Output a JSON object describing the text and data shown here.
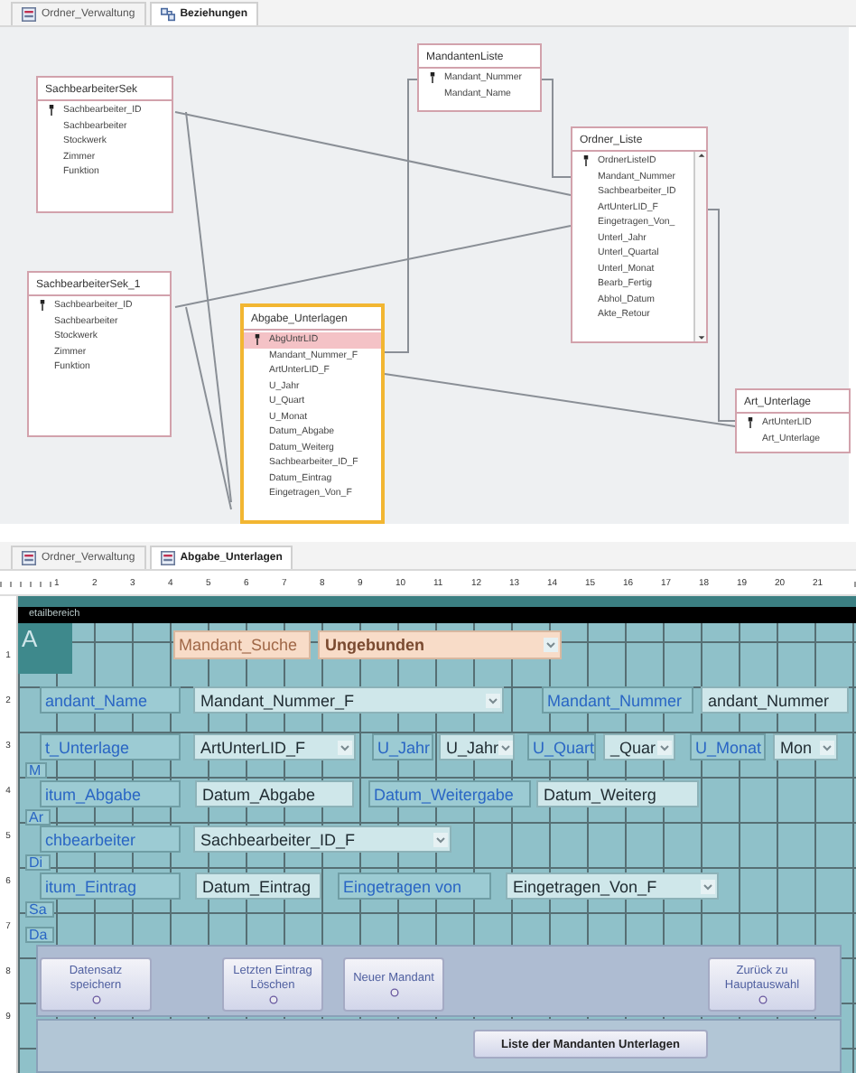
{
  "relationships": {
    "tabs": [
      {
        "label": "Ordner_Verwaltung",
        "selected": false,
        "kind": "form"
      },
      {
        "label": "Beziehungen",
        "selected": true,
        "kind": "relations"
      }
    ],
    "tables": [
      {
        "title": "SachbearbeiterSek",
        "selected": false,
        "has_key": true,
        "scrollable": false,
        "fields": [
          "Sachbearbeiter_ID",
          "Sachbearbeiter",
          "Stockwerk",
          "Zimmer",
          "Funktion"
        ]
      },
      {
        "title": "SachbearbeiterSek_1",
        "selected": false,
        "has_key": true,
        "scrollable": false,
        "fields": [
          "Sachbearbeiter_ID",
          "Sachbearbeiter",
          "Stockwerk",
          "Zimmer",
          "Funktion"
        ]
      },
      {
        "title": "Abgabe_Unterlagen",
        "selected": true,
        "has_key": true,
        "scrollable": false,
        "fields": [
          "AbgUntrLID",
          "Mandant_Nummer_F",
          "ArtUnterLID_F",
          "U_Jahr",
          "U_Quart",
          "U_Monat",
          "Datum_Abgabe",
          "Datum_Weiterg",
          "Sachbearbeiter_ID_F",
          "Datum_Eintrag",
          "Eingetragen_Von_F"
        ]
      },
      {
        "title": "MandantenListe",
        "selected": false,
        "has_key": true,
        "scrollable": false,
        "fields": [
          "Mandant_Nummer",
          "Mandant_Name"
        ]
      },
      {
        "title": "Ordner_Liste",
        "selected": false,
        "has_key": true,
        "scrollable": true,
        "fields": [
          "OrdnerListeID",
          "Mandant_Nummer",
          "Sachbearbeiter_ID",
          "ArtUnterLID_F",
          "Eingetragen_Von_",
          "Unterl_Jahr",
          "Unterl_Quartal",
          "Unterl_Monat",
          "Bearb_Fertig",
          "Abhol_Datum",
          "Akte_Retour"
        ]
      },
      {
        "title": "Art_Unterlage",
        "selected": false,
        "has_key": true,
        "scrollable": false,
        "fields": [
          "ArtUnterLID",
          "Art_Unterlage"
        ]
      }
    ]
  },
  "form_design": {
    "tabs": [
      {
        "label": "Ordner_Verwaltung",
        "selected": false,
        "kind": "form"
      },
      {
        "label": "Abgabe_Unterlagen",
        "selected": true,
        "kind": "form"
      }
    ],
    "ruler_marks": [
      "1",
      "2",
      "3",
      "4",
      "5",
      "6",
      "7",
      "8",
      "9",
      "10",
      "11",
      "12",
      "13",
      "14",
      "15",
      "16",
      "17",
      "18",
      "19",
      "20",
      "21"
    ],
    "vertical_ruler_marks": [
      "1",
      "2",
      "3",
      "4",
      "5",
      "6",
      "7",
      "8",
      "9"
    ],
    "section_title": "etailbereich",
    "header_letter": "A",
    "controls": [
      {
        "kind": "stub",
        "text": "M"
      },
      {
        "kind": "stub",
        "text": "Ar"
      },
      {
        "kind": "stub",
        "text": "Di"
      },
      {
        "kind": "stub",
        "text": "Sa"
      },
      {
        "kind": "stub",
        "text": "Da"
      },
      {
        "kind": "label",
        "search": true,
        "text": "Mandant_Suche"
      },
      {
        "kind": "combo",
        "search": true,
        "text": "Ungebunden"
      },
      {
        "kind": "label",
        "search": false,
        "text": "andant_Name"
      },
      {
        "kind": "combo",
        "search": false,
        "text": "Mandant_Nummer_F"
      },
      {
        "kind": "label",
        "search": false,
        "text": "Mandant_Nummer"
      },
      {
        "kind": "field",
        "search": false,
        "text": "andant_Nummer"
      },
      {
        "kind": "label",
        "search": false,
        "text": "t_Unterlage"
      },
      {
        "kind": "combo",
        "search": false,
        "text": "ArtUnterLID_F"
      },
      {
        "kind": "label",
        "search": false,
        "text": "U_Jahr"
      },
      {
        "kind": "combo",
        "search": false,
        "text": "U_Jahr"
      },
      {
        "kind": "label",
        "search": false,
        "text": "U_Quart"
      },
      {
        "kind": "combo",
        "search": false,
        "text": "_Quar"
      },
      {
        "kind": "label",
        "search": false,
        "text": "U_Monat"
      },
      {
        "kind": "combo",
        "search": false,
        "text": "Mon"
      },
      {
        "kind": "label",
        "search": false,
        "text": "itum_Abgabe"
      },
      {
        "kind": "field",
        "search": false,
        "text": "Datum_Abgabe"
      },
      {
        "kind": "label",
        "search": false,
        "text": "Datum_Weitergabe"
      },
      {
        "kind": "field",
        "search": false,
        "text": "Datum_Weiterg"
      },
      {
        "kind": "label",
        "search": false,
        "text": "chbearbeiter"
      },
      {
        "kind": "combo",
        "search": false,
        "text": "Sachbearbeiter_ID_F"
      },
      {
        "kind": "label",
        "search": false,
        "text": "itum_Eintrag"
      },
      {
        "kind": "field",
        "search": false,
        "text": "Datum_Eintrag"
      },
      {
        "kind": "label",
        "search": false,
        "text": "Eingetragen von"
      },
      {
        "kind": "combo",
        "search": false,
        "text": "Eingetragen_Von_F"
      }
    ],
    "buttons": [
      {
        "label": "Datensatz speichern"
      },
      {
        "label": "Letzten Eintrag Löschen"
      },
      {
        "label": "Neuer Mandant"
      },
      {
        "label": "Zurück zu Hauptauswahl"
      }
    ],
    "list_button": {
      "label": "Liste der Mandanten Unterlagen"
    }
  }
}
